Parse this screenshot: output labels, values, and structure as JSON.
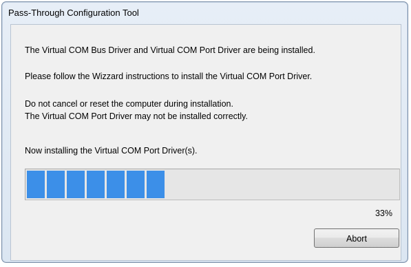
{
  "window": {
    "title": "Pass-Through Configuration Tool"
  },
  "messages": {
    "line1": "The Virtual COM Bus Driver and Virtual COM Port Driver are being installed.",
    "line2": "Please follow the Wizzard instructions to install the Virtual COM Port Driver.",
    "line3": "Do not cancel or reset the computer during installation.",
    "line4": "The Virtual COM Port Driver may not be installed correctly.",
    "line5": "Now installing the Virtual COM Port Driver(s)."
  },
  "progress": {
    "value": 0.375,
    "label": "33%",
    "color": "#3c8fe8"
  },
  "buttons": {
    "abort_label": "Abort"
  }
}
